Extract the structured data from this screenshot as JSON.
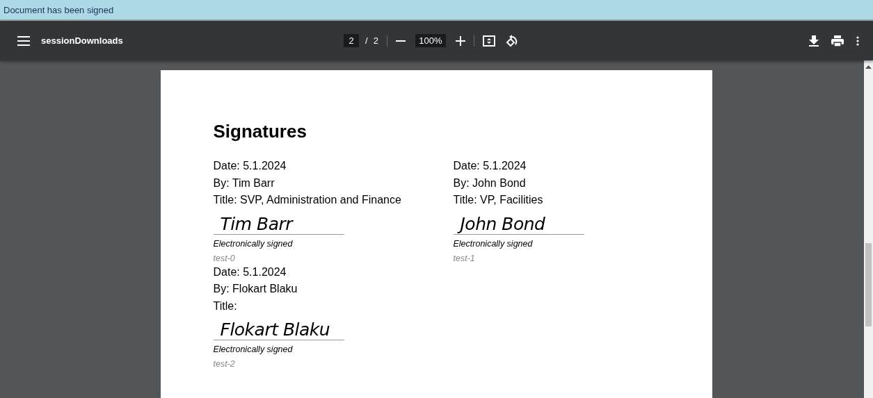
{
  "banner": {
    "message": "Document has been signed"
  },
  "toolbar": {
    "title": "sessionDownloads",
    "page_number": "2",
    "page_separator": "/",
    "page_count": "2",
    "zoom": "100%"
  },
  "document": {
    "heading": "Signatures",
    "signatures": [
      {
        "date": "Date: 5.1.2024",
        "by": "By: Tim Barr",
        "title": "Title: SVP, Administration and Finance",
        "signature": "Tim Barr",
        "note": "Electronically signed",
        "id": "test-0"
      },
      {
        "date": "Date: 5.1.2024",
        "by": "By: John Bond",
        "title": "Title: VP, Facilities",
        "signature": "John Bond",
        "note": "Electronically signed",
        "id": "test-1"
      },
      {
        "date": "Date: 5.1.2024",
        "by": "By: Flokart Blaku",
        "title": "Title:",
        "signature": "Flokart Blaku",
        "note": "Electronically signed",
        "id": "test-2"
      }
    ]
  }
}
